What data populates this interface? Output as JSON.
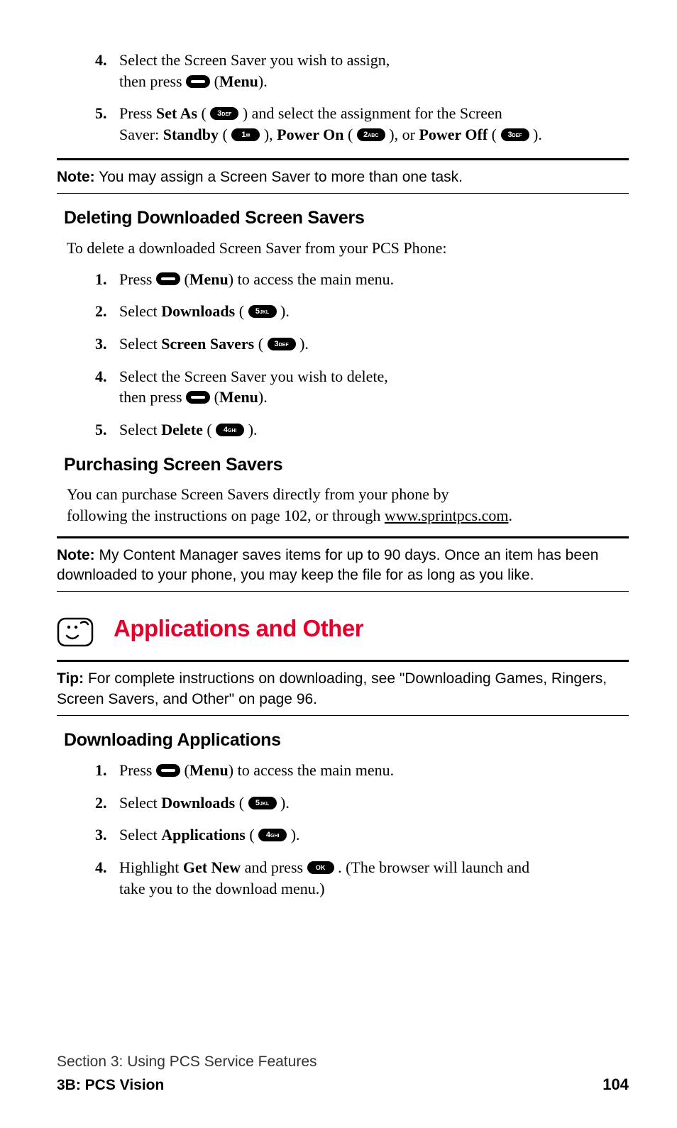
{
  "topSteps": {
    "s4": {
      "num": "4.",
      "t1": "Select the Screen Saver you wish to assign,",
      "t2a": "then press ",
      "t2b": " (",
      "menu": "Menu",
      "t2c": ")."
    },
    "s5": {
      "num": "5.",
      "t1a": "Press ",
      "setas": "Set As",
      "t1b": " ( ",
      "k3": "3",
      "k3s": "DEF",
      "t1c": " ) and select the assignment for the Screen",
      "t2a": "Saver: ",
      "standby": "Standby",
      "t2b": " ( ",
      "k1": "1",
      "k1s": "✉",
      "t2c": " ), ",
      "poweron": "Power On",
      "t2d": " ( ",
      "k2": "2",
      "k2s": "ABC",
      "t2e": " ), or ",
      "poweroff": "Power Off",
      "t2f": " ( ",
      "k3b": "3",
      "k3bs": "DEF",
      "t2g": " )."
    }
  },
  "note1": {
    "label": "Note:",
    "text": " You may assign a Screen Saver to more than one task."
  },
  "delHeading": "Deleting Downloaded Screen Savers",
  "delIntro": "To delete a downloaded Screen Saver from your PCS Phone:",
  "delSteps": {
    "s1": {
      "num": "1.",
      "a": "Press ",
      "b": " (",
      "menu": "Menu",
      "c": ") to access the main menu."
    },
    "s2": {
      "num": "2.",
      "a": "Select ",
      "dl": "Downloads",
      "b": " ( ",
      "k": "5",
      "ks": "JKL",
      "c": " )."
    },
    "s3": {
      "num": "3.",
      "a": "Select ",
      "ss": "Screen Savers",
      "b": " ( ",
      "k": "3",
      "ks": "DEF",
      "c": " )."
    },
    "s4": {
      "num": "4.",
      "a": "Select the Screen Saver you wish to delete,",
      "b": "then press ",
      "c": " (",
      "menu": "Menu",
      "d": ")."
    },
    "s5": {
      "num": "5.",
      "a": "Select ",
      "del": "Delete",
      "b": " ( ",
      "k": "4",
      "ks": "GHI",
      "c": " )."
    }
  },
  "purHeading": "Purchasing Screen Savers",
  "purText1": "You can purchase Screen Savers directly from your phone by",
  "purText2a": "following the instructions on page 102, or through ",
  "purLink": "www.sprintpcs.com",
  "purText2b": ".",
  "note2": {
    "label": "Note:",
    "text": " My Content Manager saves items for up to 90 days. Once an item has been downloaded to your phone, you may keep the file for as long as you like."
  },
  "sectionTitle": "Applications and Other",
  "tip": {
    "label": "Tip:",
    "text": " For complete instructions on downloading, see \"Downloading Games, Ringers, Screen Savers, and Other\" on page 96."
  },
  "dlHeading": "Downloading Applications",
  "dlSteps": {
    "s1": {
      "num": "1.",
      "a": "Press ",
      "b": " (",
      "menu": "Menu",
      "c": ") to access the main menu."
    },
    "s2": {
      "num": "2.",
      "a": "Select ",
      "dl": "Downloads",
      "b": " ( ",
      "k": "5",
      "ks": "JKL",
      "c": " )."
    },
    "s3": {
      "num": "3.",
      "a": "Select ",
      "app": "Applications",
      "b": " ( ",
      "k": "4",
      "ks": "GHI",
      "c": " )."
    },
    "s4": {
      "num": "4.",
      "a": "Highlight ",
      "gn": "Get New",
      "b": " and press ",
      "ok": "OK",
      "c": " . (The browser will launch and",
      "d": "take you to the download menu.)"
    }
  },
  "footer": {
    "line1": "Section 3: Using PCS Service Features",
    "line2": "3B: PCS Vision",
    "page": "104"
  }
}
